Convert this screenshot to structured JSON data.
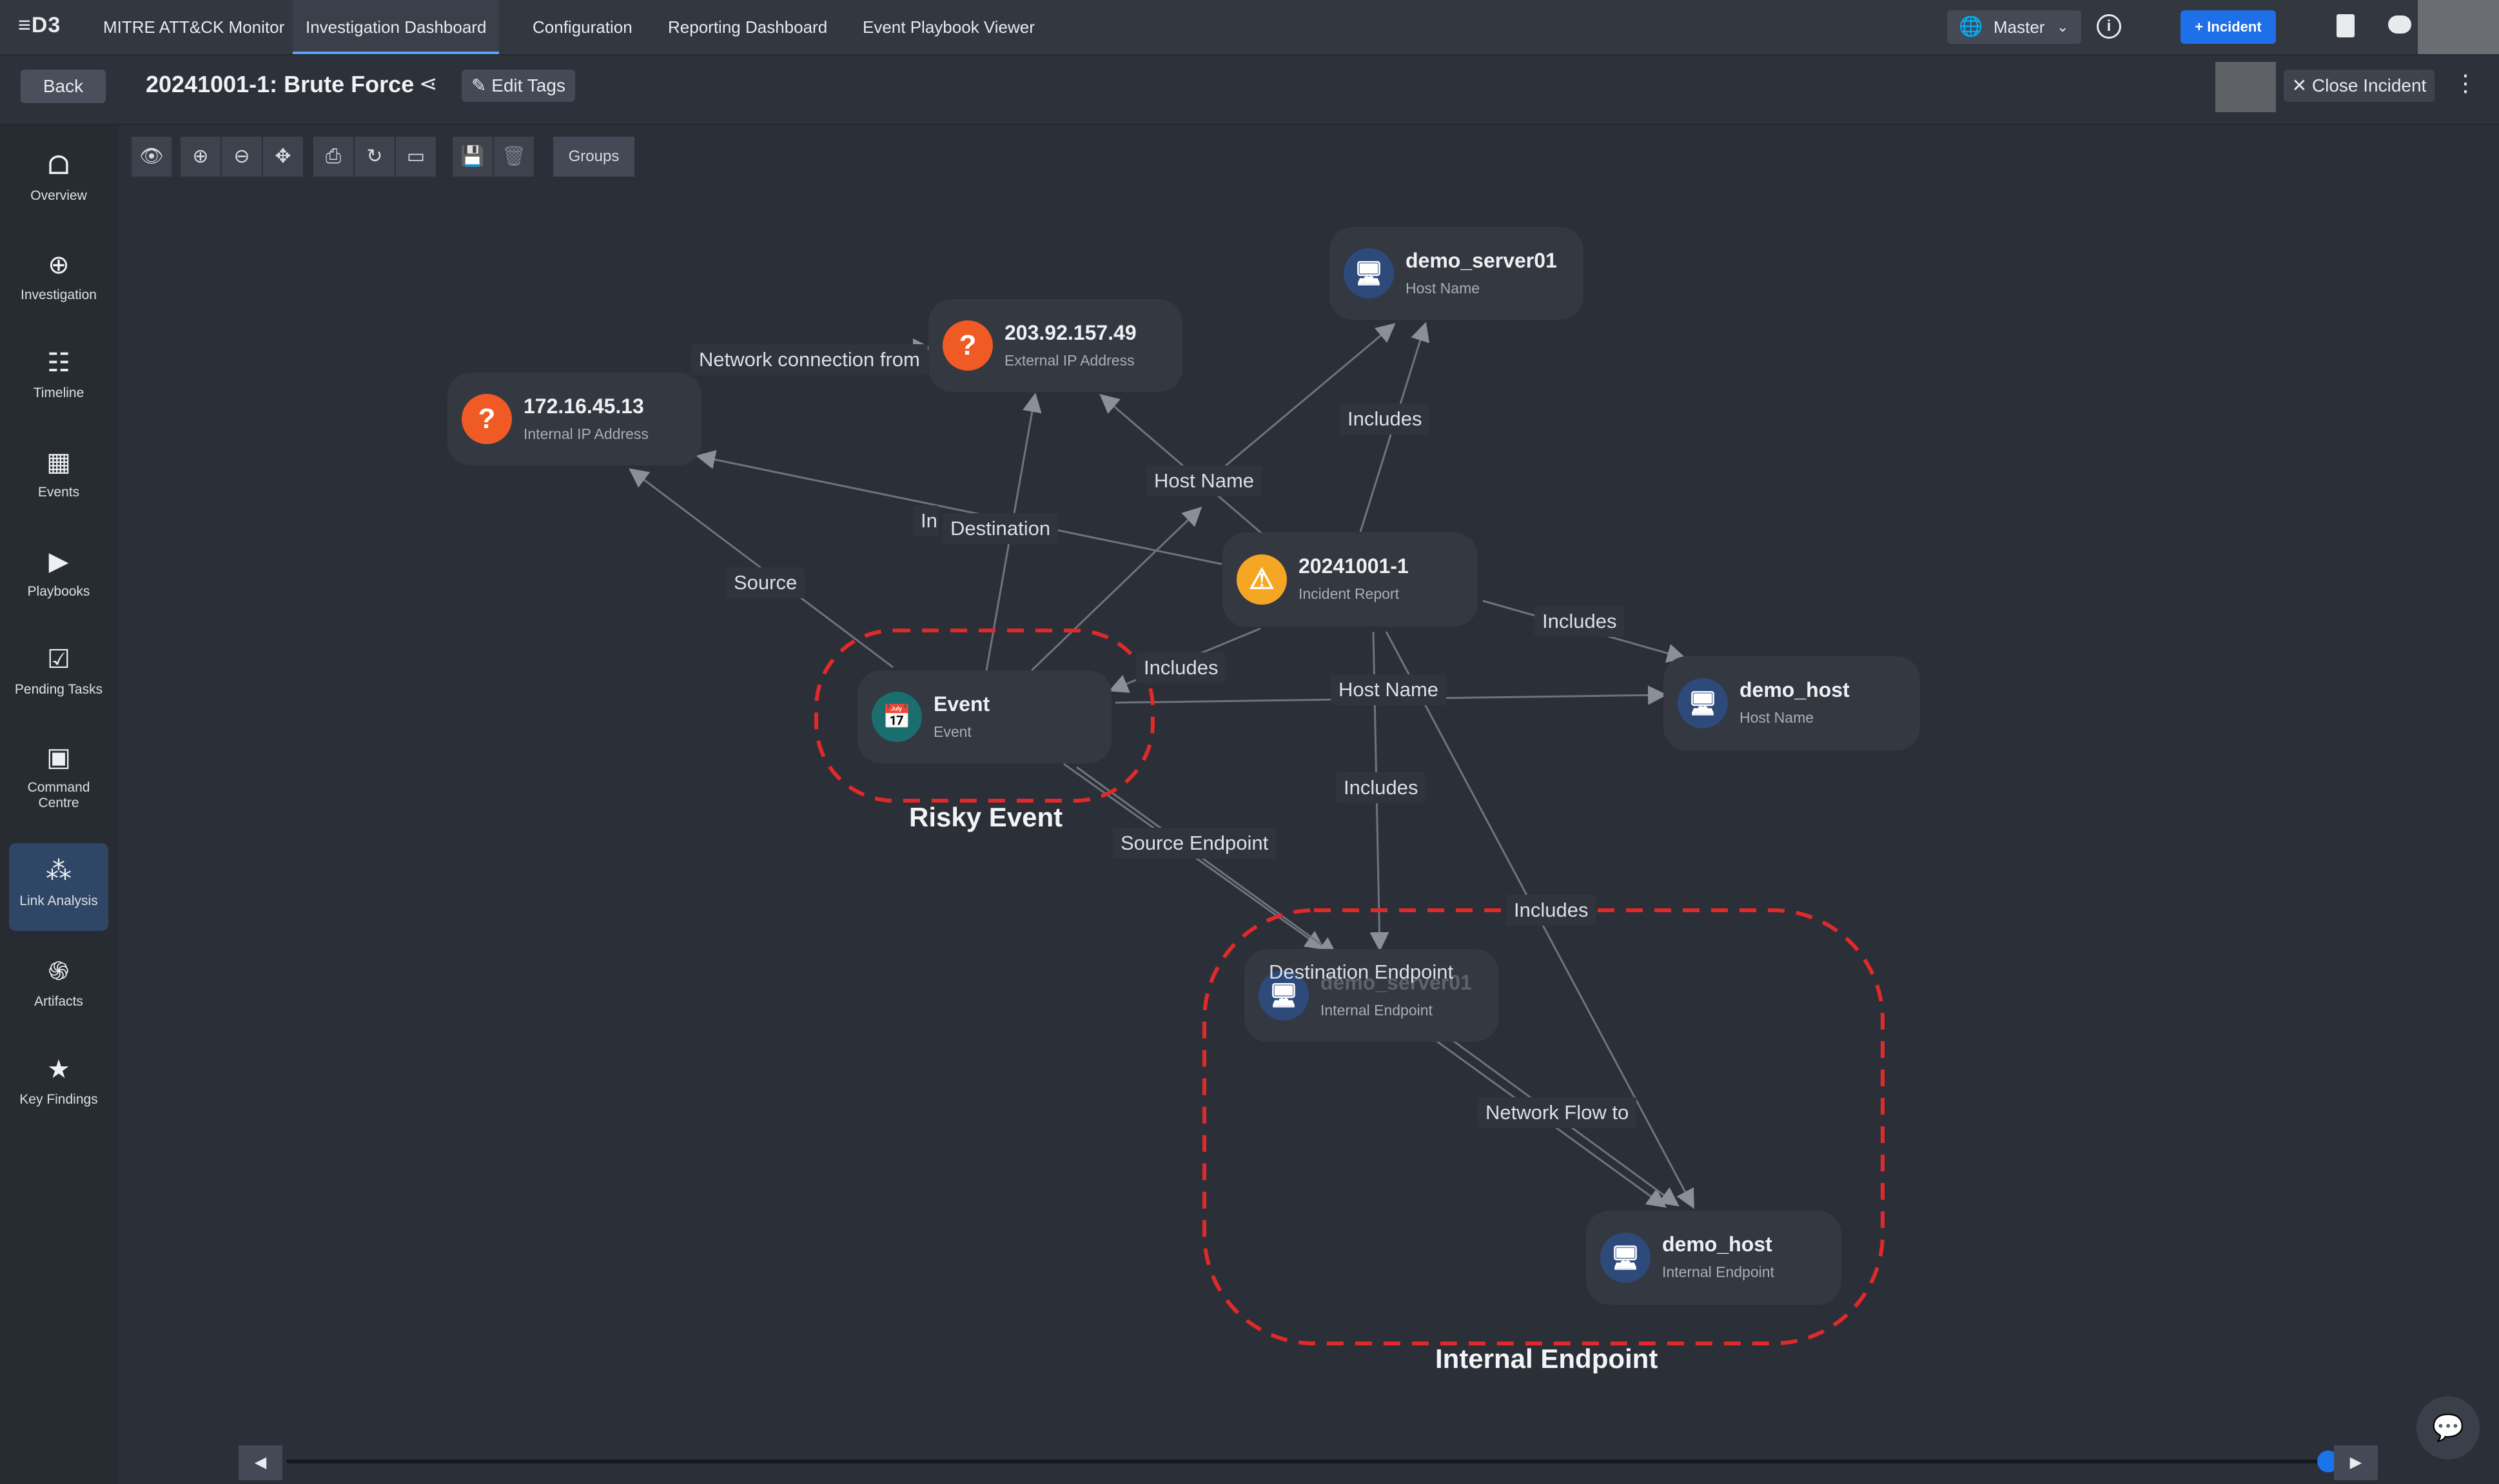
{
  "app": {
    "logo": "≡D3"
  },
  "nav": {
    "tabs": [
      {
        "label": "MITRE ATT&CK Monitor"
      },
      {
        "label": "Investigation Dashboard"
      },
      {
        "label": "Configuration"
      },
      {
        "label": "Reporting Dashboard"
      },
      {
        "label": "Event Playbook Viewer"
      }
    ],
    "master_label": "Master",
    "incident_button": "+ Incident"
  },
  "subheader": {
    "back_label": "Back",
    "title": "20241001-1: Brute Force",
    "edit_tags_label": "Edit Tags",
    "close_incident_label": "✕ Close Incident"
  },
  "sidebar": {
    "items": [
      {
        "label": "Overview",
        "icon": "binoculars-icon"
      },
      {
        "label": "Investigation",
        "icon": "crosshair-icon"
      },
      {
        "label": "Timeline",
        "icon": "timeline-icon"
      },
      {
        "label": "Events",
        "icon": "calendar-alert-icon"
      },
      {
        "label": "Playbooks",
        "icon": "playbook-icon"
      },
      {
        "label": "Pending Tasks",
        "icon": "checklist-icon"
      },
      {
        "label": "Command Centre",
        "icon": "terminal-icon"
      },
      {
        "label": "Link Analysis",
        "icon": "graph-icon",
        "active": true
      },
      {
        "label": "Artifacts",
        "icon": "fingerprint-icon"
      },
      {
        "label": "Key Findings",
        "icon": "star-icon"
      }
    ]
  },
  "toolbar": {
    "groups_label": "Groups"
  },
  "graph": {
    "nodes": {
      "demo_server01_top": {
        "title": "demo_server01",
        "sub": "Host Name"
      },
      "ip_external": {
        "title": "203.92.157.49",
        "sub": "External IP Address"
      },
      "ip_internal": {
        "title": "172.16.45.13",
        "sub": "Internal IP Address"
      },
      "incident": {
        "title": "20241001-1",
        "sub": "Incident Report"
      },
      "event": {
        "title": "Event",
        "sub": "Event"
      },
      "demo_host_hostname": {
        "title": "demo_host",
        "sub": "Host Name"
      },
      "demo_server01_endpoint": {
        "title": "demo_server01",
        "sub": "Internal Endpoint"
      },
      "demo_host_endpoint": {
        "title": "demo_host",
        "sub": "Internal Endpoint"
      }
    },
    "edge_labels": {
      "network_connection_from": "Network connection from",
      "includes_top": "Includes",
      "host_name_top": "Host Name",
      "in_partial": "In",
      "destination": "Destination",
      "source": "Source",
      "includes_right": "Includes",
      "includes_event": "Includes",
      "host_name_mid": "Host Name",
      "includes_mid": "Includes",
      "source_endpoint": "Source Endpoint",
      "includes_lower": "Includes",
      "destination_endpoint": "Destination Endpoint",
      "network_flow_to": "Network Flow to"
    },
    "groups": {
      "risky_event": "Risky Event",
      "internal_endpoint": "Internal Endpoint"
    }
  },
  "colors": {
    "accent": "#1f6fe8",
    "question_node": "#f05a24",
    "warning_node": "#f5a623",
    "event_node": "#1a6e6e",
    "host_node": "#2e4a7a",
    "group_outline": "#e02a2a"
  }
}
